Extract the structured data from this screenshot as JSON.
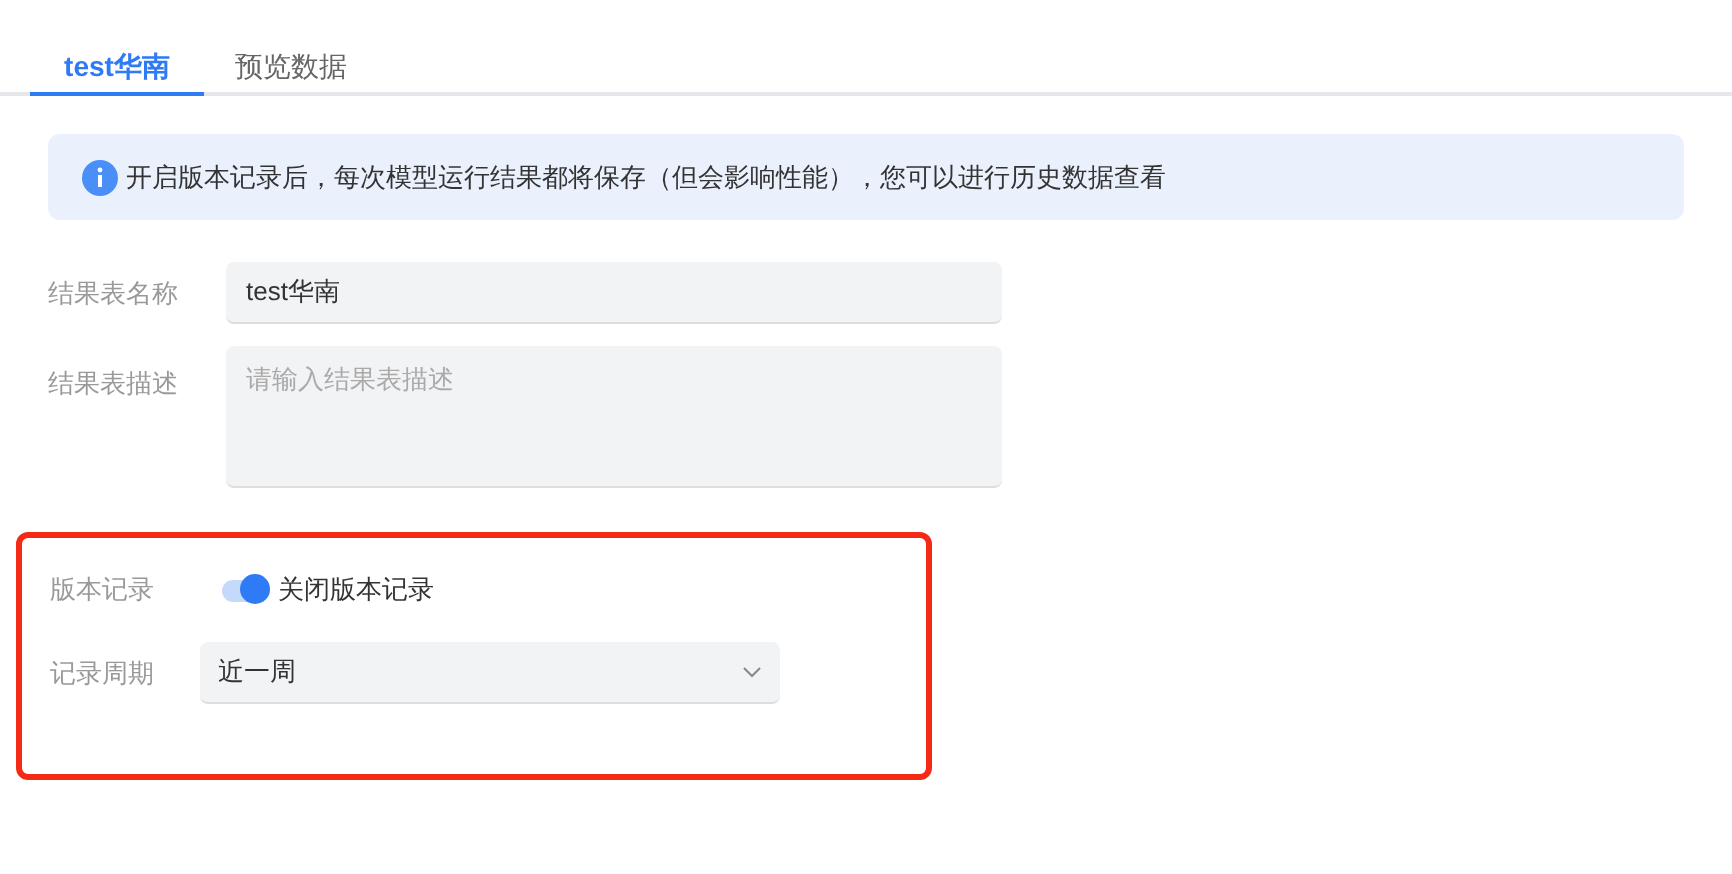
{
  "tabs": [
    {
      "label": "test华南",
      "selected": true
    },
    {
      "label": "预览数据",
      "selected": false
    }
  ],
  "alert": {
    "text": "开启版本记录后，每次模型运行结果都将保存（但会影响性能），您可以进行历史数据查看"
  },
  "form": {
    "name": {
      "label": "结果表名称",
      "value": "test华南"
    },
    "description": {
      "label": "结果表描述",
      "placeholder": "请输入结果表描述"
    }
  },
  "version_section": {
    "highlighted": true,
    "record": {
      "label": "版本记录",
      "on": true,
      "text": "关闭版本记录"
    },
    "period": {
      "label": "记录周期",
      "value": "近一周"
    }
  }
}
